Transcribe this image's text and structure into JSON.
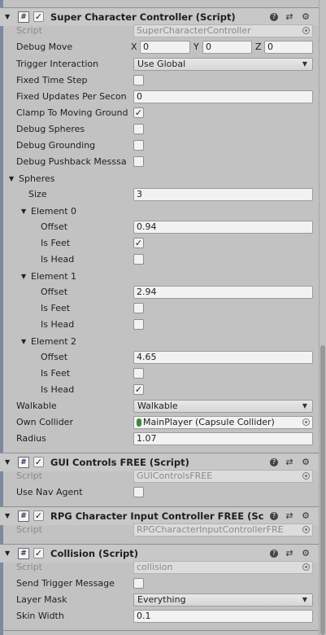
{
  "super_controller": {
    "title": "Super Character Controller (Script)",
    "script_label": "Script",
    "script_value": "SuperCharacterController",
    "debug_move_label": "Debug Move",
    "debug_move": {
      "x_label": "X",
      "x": "0",
      "y_label": "Y",
      "y": "0",
      "z_label": "Z",
      "z": "0"
    },
    "trigger_interaction_label": "Trigger Interaction",
    "trigger_interaction_value": "Use Global",
    "fixed_time_step_label": "Fixed Time Step",
    "fixed_time_step": false,
    "fixed_updates_label": "Fixed Updates Per Secon",
    "fixed_updates_value": "0",
    "clamp_label": "Clamp To Moving Ground",
    "clamp": true,
    "debug_spheres_label": "Debug Spheres",
    "debug_spheres": false,
    "debug_grounding_label": "Debug Grounding",
    "debug_grounding": false,
    "debug_pushback_label": "Debug Pushback Messsa",
    "debug_pushback": false,
    "spheres_label": "Spheres",
    "size_label": "Size",
    "size_value": "3",
    "offset_label": "Offset",
    "is_feet_label": "Is Feet",
    "is_head_label": "Is Head",
    "elements": [
      {
        "label": "Element 0",
        "offset": "0.94",
        "is_feet": true,
        "is_head": false
      },
      {
        "label": "Element 1",
        "offset": "2.94",
        "is_feet": false,
        "is_head": false
      },
      {
        "label": "Element 2",
        "offset": "4.65",
        "is_feet": false,
        "is_head": true
      }
    ],
    "walkable_label": "Walkable",
    "walkable_value": "Walkable",
    "own_collider_label": "Own Collider",
    "own_collider_value": "MainPlayer (Capsule Collider)",
    "radius_label": "Radius",
    "radius_value": "1.07"
  },
  "gui_controls": {
    "title": "GUI Controls FREE (Script)",
    "script_label": "Script",
    "script_value": "GUIControlsFREE",
    "use_nav_agent_label": "Use Nav Agent",
    "use_nav_agent": false
  },
  "rpg_input": {
    "title": "RPG Character Input Controller FREE (Sc",
    "script_label": "Script",
    "script_value": "RPGCharacterInputControllerFRE"
  },
  "collision": {
    "title": "Collision (Script)",
    "script_label": "Script",
    "script_value": "collision",
    "send_trigger_label": "Send Trigger Message",
    "send_trigger": false,
    "layer_mask_label": "Layer Mask",
    "layer_mask_value": "Everything",
    "skin_width_label": "Skin Width",
    "skin_width_value": "0.1"
  },
  "icons": {
    "fold_open": "▼",
    "fold_collapsed": "►",
    "dropdown": "▼",
    "check": "✓",
    "help": "?",
    "presets": "⇄",
    "settings": "⚙",
    "script": "#"
  }
}
